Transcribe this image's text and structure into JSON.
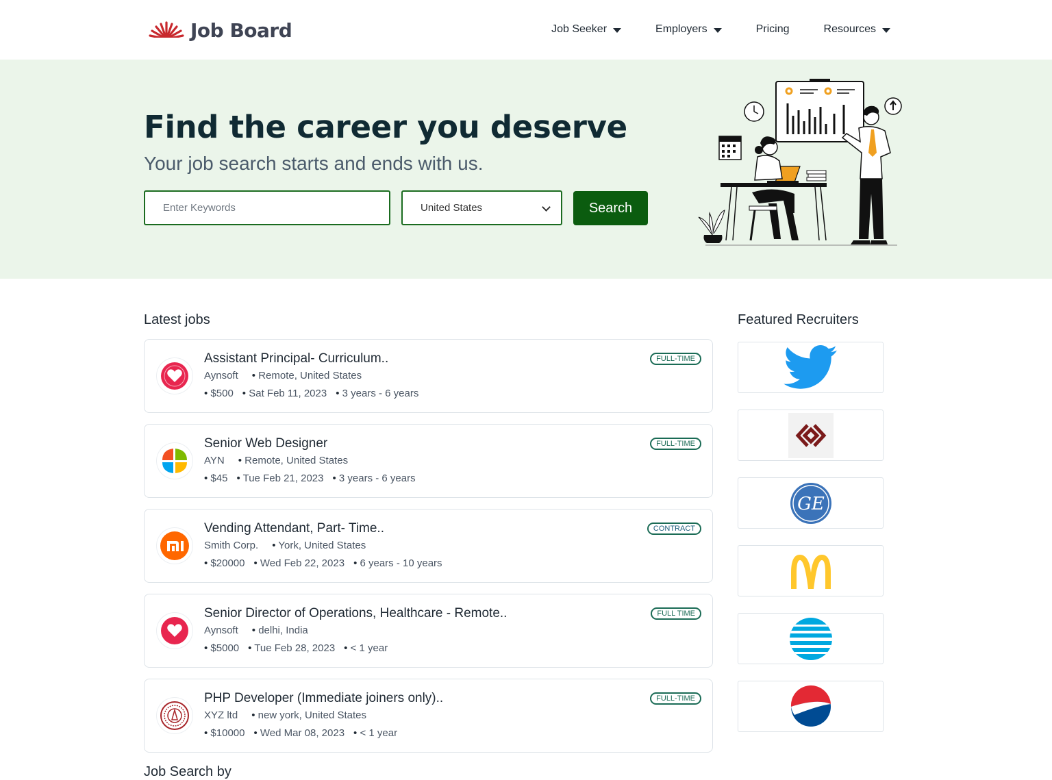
{
  "header": {
    "logo_text": "Job Board",
    "nav": [
      {
        "label": "Job Seeker",
        "has_dropdown": true
      },
      {
        "label": "Employers",
        "has_dropdown": true
      },
      {
        "label": "Pricing",
        "has_dropdown": false
      },
      {
        "label": "Resources",
        "has_dropdown": true
      }
    ]
  },
  "hero": {
    "title": "Find the career you deserve",
    "subtitle": "Your job search starts and ends with us.",
    "keywords_placeholder": "Enter Keywords",
    "keywords_value": "",
    "country_selected": "United States",
    "search_label": "Search"
  },
  "latest": {
    "title": "Latest jobs",
    "jobs": [
      {
        "title": "Assistant Principal- Curriculum..",
        "company": "Aynsoft",
        "location": "Remote, United States",
        "salary": "$500",
        "date": "Sat Feb 11, 2023",
        "experience": "3 years - 6 years",
        "type": "FULL-TIME",
        "logo_icon": "heart-logo-icon"
      },
      {
        "title": "Senior Web Designer",
        "company": "AYN",
        "location": "Remote, United States",
        "salary": "$45",
        "date": "Tue Feb 21, 2023",
        "experience": "3 years - 6 years",
        "type": "FULL-TIME",
        "logo_icon": "windows-logo-icon"
      },
      {
        "title": "Vending Attendant, Part- Time..",
        "company": "Smith Corp.",
        "location": "York, United States",
        "salary": "$20000",
        "date": "Wed Feb 22, 2023",
        "experience": "6 years - 10 years",
        "type": "CONTRACT",
        "logo_icon": "mi-logo-icon"
      },
      {
        "title": "Senior Director of Operations, Healthcare - Remote..",
        "company": "Aynsoft",
        "location": "delhi, India",
        "salary": "$5000",
        "date": "Tue Feb 28, 2023",
        "experience": "< 1 year",
        "type": "FULL TIME",
        "logo_icon": "heart-logo-icon"
      },
      {
        "title": "PHP Developer (Immediate joiners only)..",
        "company": "XYZ ltd",
        "location": "new york, United States",
        "salary": "$10000",
        "date": "Wed Mar 08, 2023",
        "experience": "< 1 year",
        "type": "FULL-TIME",
        "logo_icon": "seal-logo-icon"
      }
    ]
  },
  "recruiters": {
    "title": "Featured Recruiters",
    "items": [
      {
        "icon": "twitter-bird-icon"
      },
      {
        "icon": "diamond-chain-logo-icon"
      },
      {
        "icon": "ge-logo-icon"
      },
      {
        "icon": "mcdonalds-arches-icon"
      },
      {
        "icon": "att-globe-icon"
      },
      {
        "icon": "pepsi-globe-icon"
      }
    ]
  },
  "job_search_by": {
    "title": "Job Search by"
  },
  "colors": {
    "hero_bg": "#ebf5ea",
    "brand_green": "#0b5c0f",
    "input_border": "#1a6b1f",
    "badge_green": "#1a6b55",
    "logo_red": "#c8282d"
  }
}
